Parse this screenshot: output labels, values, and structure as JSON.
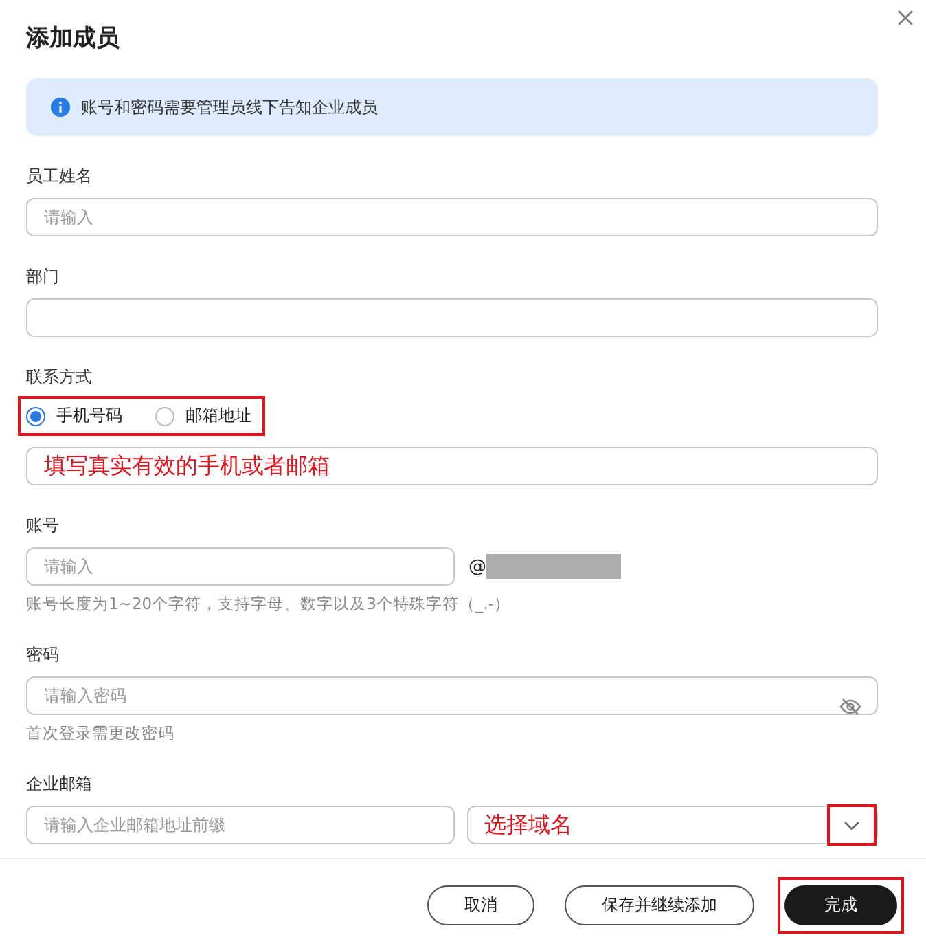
{
  "dialog": {
    "title": "添加成员",
    "notice": "账号和密码需要管理员线下告知企业成员"
  },
  "fields": [
    {
      "kind": "text",
      "label": "员工姓名",
      "placeholder": "请输入"
    },
    {
      "kind": "text",
      "label": "部门"
    },
    {
      "kind": "contact",
      "label": "联系方式",
      "highlighted": true,
      "options": [
        {
          "label": "手机号码",
          "selected": true
        },
        {
          "label": "邮箱地址",
          "selected": false
        }
      ],
      "annotation": "填写真实有效的手机或者邮箱"
    },
    {
      "kind": "account",
      "label": "账号",
      "placeholder": "请输入",
      "suffix": "@",
      "hint": "账号长度为1~20个字符，支持字母、数字以及3个特殊字符（_.-）"
    },
    {
      "kind": "password",
      "label": "密码",
      "placeholder": "请输入密码",
      "hint": "首次登录需更改密码"
    },
    {
      "kind": "email",
      "label": "企业邮箱",
      "placeholder": "请输入企业邮箱地址前缀",
      "annotation": "选择域名",
      "caret_highlighted": true
    }
  ],
  "buttons": [
    {
      "label": "取消",
      "kind": "secondary",
      "highlighted": false
    },
    {
      "label": "保存并继续添加",
      "kind": "secondary",
      "highlighted": false
    },
    {
      "label": "完成",
      "kind": "primary",
      "highlighted": true
    }
  ]
}
